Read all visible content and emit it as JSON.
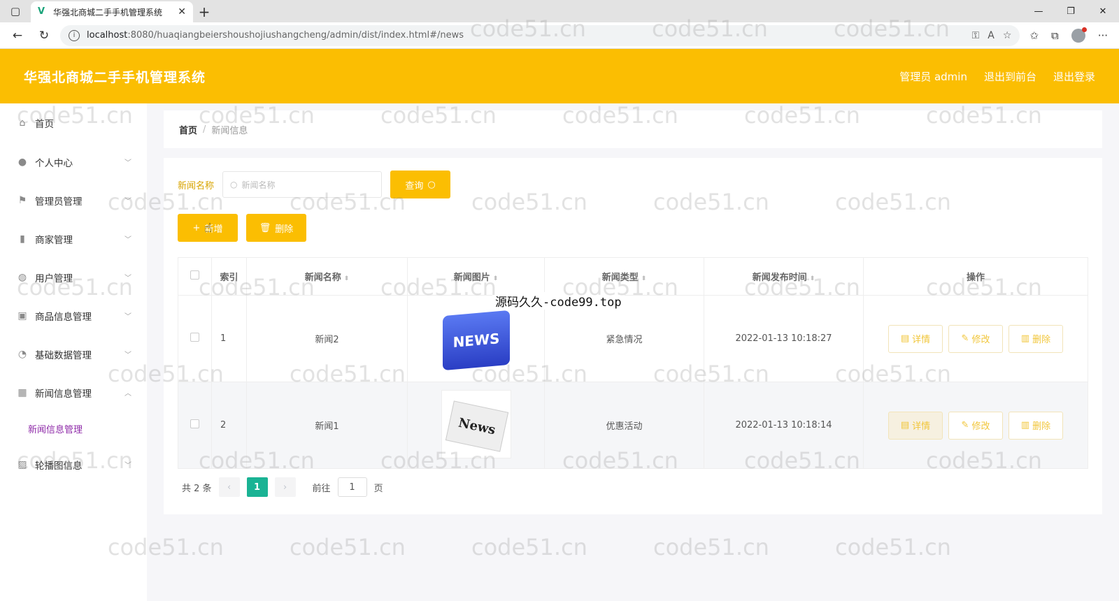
{
  "browser": {
    "tab_title": "华强北商城二手手机管理系统",
    "url_host": "localhost",
    "url_path": ":8080/huaqiangbeiershoushojiushangcheng/admin/dist/index.html#/news"
  },
  "header": {
    "title": "华强北商城二手手机管理系统",
    "links": [
      "管理员 admin",
      "退出到前台",
      "退出登录"
    ]
  },
  "sidebar": {
    "items": [
      {
        "label": "首页",
        "icon": "home-icon"
      },
      {
        "label": "个人中心",
        "icon": "user-icon"
      },
      {
        "label": "管理员管理",
        "icon": "flag-icon"
      },
      {
        "label": "商家管理",
        "icon": "bar-chart-icon"
      },
      {
        "label": "用户管理",
        "icon": "globe-icon"
      },
      {
        "label": "商品信息管理",
        "icon": "box-icon"
      },
      {
        "label": "基础数据管理",
        "icon": "compass-icon"
      },
      {
        "label": "新闻信息管理",
        "icon": "grid-icon"
      },
      {
        "label": "轮播图信息",
        "icon": "image-icon"
      }
    ],
    "submenu_label": "新闻信息管理"
  },
  "breadcrumb": {
    "home": "首页",
    "current": "新闻信息"
  },
  "search": {
    "label": "新闻名称",
    "placeholder": "新闻名称",
    "button": "查询"
  },
  "actions": {
    "add": "新增",
    "delete": "删除"
  },
  "table": {
    "headers": [
      "索引",
      "新闻名称",
      "新闻图片",
      "新闻类型",
      "新闻发布时间",
      "操作"
    ],
    "rows": [
      {
        "index": "1",
        "name": "新闻2",
        "image_text": "NEWS",
        "type": "紧急情况",
        "time": "2022-01-13 10:18:27"
      },
      {
        "index": "2",
        "name": "新闻1",
        "image_text": "News",
        "type": "优惠活动",
        "time": "2022-01-13 10:18:14"
      }
    ],
    "row_actions": {
      "detail": "详情",
      "edit": "修改",
      "delete": "删除"
    }
  },
  "overlay_text": "源码久久-code99.top",
  "pager": {
    "total": "共 2 条",
    "current_page": "1",
    "goto_label": "前往",
    "goto_value": "1",
    "page_suffix": "页"
  },
  "watermark": "code51.cn",
  "colors": {
    "accent": "#fbbe02",
    "page_active": "#1ab394",
    "submenu_active": "#8e2aa8"
  }
}
